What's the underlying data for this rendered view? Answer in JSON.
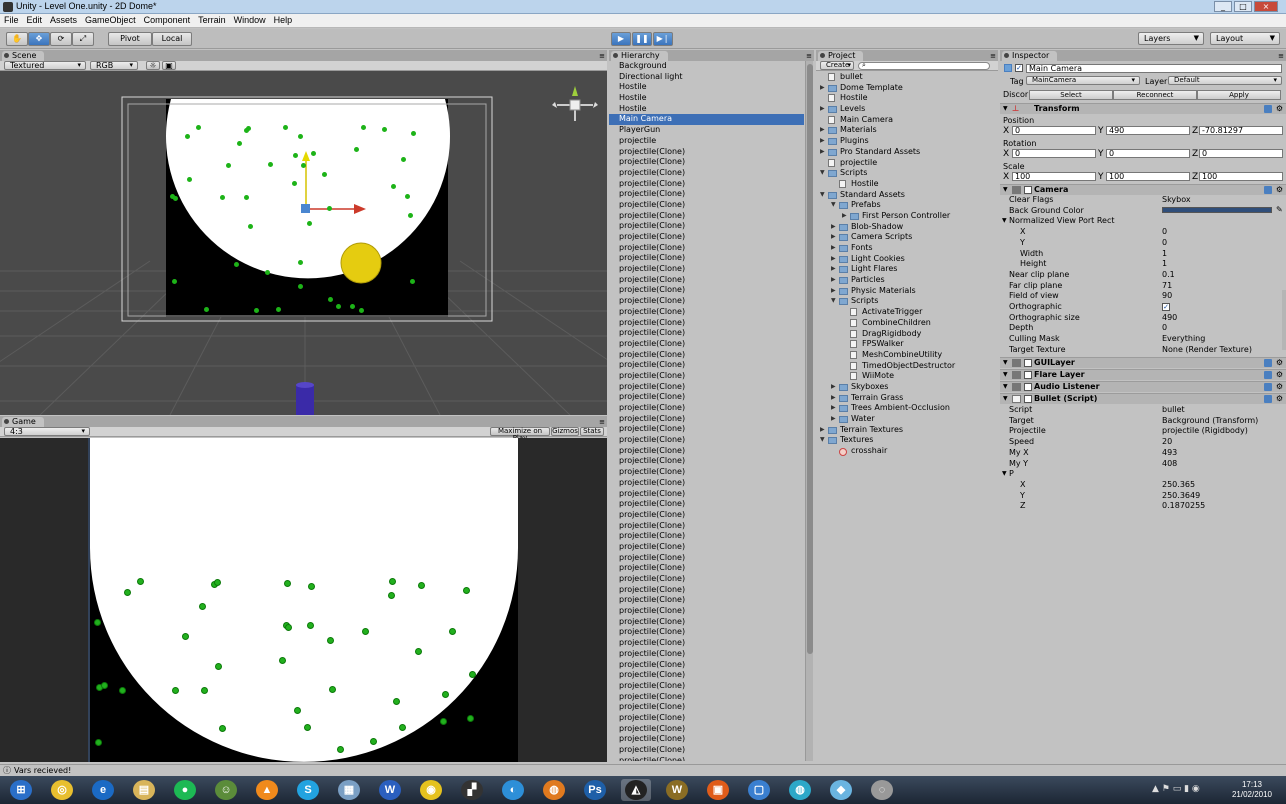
{
  "window": {
    "title": "Unity - Level One.unity - 2D Dome*",
    "controls": [
      "_",
      "□",
      "×"
    ]
  },
  "menu": [
    "File",
    "Edit",
    "Assets",
    "GameObject",
    "Component",
    "Terrain",
    "Window",
    "Help"
  ],
  "toolbar": {
    "pivot_label": "Pivot",
    "local_label": "Local",
    "layers_label": "Layers",
    "layout_label": "Layout"
  },
  "scene": {
    "tab_label": "Scene",
    "render_mode": "Textured",
    "color_mode": "RGB"
  },
  "game": {
    "tab_label": "Game",
    "aspect": "4:3",
    "maximize_label": "Maximize on Play",
    "gizmos_label": "Gizmos",
    "stats_label": "Stats"
  },
  "hierarchy": {
    "tab_label": "Hierarchy",
    "items": [
      "Background",
      "Directional light",
      "Hostile",
      "Hostile",
      "Hostile",
      "Main Camera",
      "PlayerGun",
      "projectile",
      "projectile(Clone)",
      "projectile(Clone)",
      "projectile(Clone)",
      "projectile(Clone)",
      "projectile(Clone)",
      "projectile(Clone)",
      "projectile(Clone)",
      "projectile(Clone)",
      "projectile(Clone)",
      "projectile(Clone)",
      "projectile(Clone)",
      "projectile(Clone)",
      "projectile(Clone)",
      "projectile(Clone)",
      "projectile(Clone)",
      "projectile(Clone)",
      "projectile(Clone)",
      "projectile(Clone)",
      "projectile(Clone)",
      "projectile(Clone)",
      "projectile(Clone)",
      "projectile(Clone)",
      "projectile(Clone)",
      "projectile(Clone)",
      "projectile(Clone)",
      "projectile(Clone)",
      "projectile(Clone)",
      "projectile(Clone)",
      "projectile(Clone)",
      "projectile(Clone)",
      "projectile(Clone)",
      "projectile(Clone)",
      "projectile(Clone)",
      "projectile(Clone)",
      "projectile(Clone)",
      "projectile(Clone)",
      "projectile(Clone)",
      "projectile(Clone)",
      "projectile(Clone)",
      "projectile(Clone)",
      "projectile(Clone)",
      "projectile(Clone)",
      "projectile(Clone)",
      "projectile(Clone)",
      "projectile(Clone)",
      "projectile(Clone)",
      "projectile(Clone)",
      "projectile(Clone)",
      "projectile(Clone)",
      "projectile(Clone)",
      "projectile(Clone)",
      "projectile(Clone)",
      "projectile(Clone)",
      "projectile(Clone)",
      "projectile(Clone)",
      "projectile(Clone)",
      "projectile(Clone)",
      "projectile(Clone)"
    ],
    "selected": "Main Camera"
  },
  "project": {
    "tab_label": "Project",
    "create_label": "Create",
    "items": [
      {
        "label": "bullet",
        "depth": 0,
        "kind": "file",
        "expand": ""
      },
      {
        "label": "Dome Template",
        "depth": 0,
        "kind": "folder",
        "expand": "▶"
      },
      {
        "label": "Hostile",
        "depth": 0,
        "kind": "file",
        "expand": ""
      },
      {
        "label": "Levels",
        "depth": 0,
        "kind": "folder",
        "expand": "▶"
      },
      {
        "label": "Main Camera",
        "depth": 0,
        "kind": "file",
        "expand": ""
      },
      {
        "label": "Materials",
        "depth": 0,
        "kind": "folder",
        "expand": "▶"
      },
      {
        "label": "Plugins",
        "depth": 0,
        "kind": "folder",
        "expand": "▶"
      },
      {
        "label": "Pro Standard Assets",
        "depth": 0,
        "kind": "folder",
        "expand": "▶"
      },
      {
        "label": "projectile",
        "depth": 0,
        "kind": "file",
        "expand": ""
      },
      {
        "label": "Scripts",
        "depth": 0,
        "kind": "folder",
        "expand": "▼"
      },
      {
        "label": "Hostile",
        "depth": 1,
        "kind": "file",
        "expand": ""
      },
      {
        "label": "Standard Assets",
        "depth": 0,
        "kind": "folder",
        "expand": "▼"
      },
      {
        "label": "Prefabs",
        "depth": 1,
        "kind": "folder",
        "expand": "▼"
      },
      {
        "label": "First Person Controller",
        "depth": 2,
        "kind": "folder",
        "expand": "▶"
      },
      {
        "label": "Blob-Shadow",
        "depth": 1,
        "kind": "folder",
        "expand": "▶"
      },
      {
        "label": "Camera Scripts",
        "depth": 1,
        "kind": "folder",
        "expand": "▶"
      },
      {
        "label": "Fonts",
        "depth": 1,
        "kind": "folder",
        "expand": "▶"
      },
      {
        "label": "Light Cookies",
        "depth": 1,
        "kind": "folder",
        "expand": "▶"
      },
      {
        "label": "Light Flares",
        "depth": 1,
        "kind": "folder",
        "expand": "▶"
      },
      {
        "label": "Particles",
        "depth": 1,
        "kind": "folder",
        "expand": "▶"
      },
      {
        "label": "Physic Materials",
        "depth": 1,
        "kind": "folder",
        "expand": "▶"
      },
      {
        "label": "Scripts",
        "depth": 1,
        "kind": "folder",
        "expand": "▼"
      },
      {
        "label": "ActivateTrigger",
        "depth": 2,
        "kind": "file",
        "expand": ""
      },
      {
        "label": "CombineChildren",
        "depth": 2,
        "kind": "file",
        "expand": ""
      },
      {
        "label": "DragRigidbody",
        "depth": 2,
        "kind": "file",
        "expand": ""
      },
      {
        "label": "FPSWalker",
        "depth": 2,
        "kind": "file",
        "expand": ""
      },
      {
        "label": "MeshCombineUtility",
        "depth": 2,
        "kind": "file",
        "expand": ""
      },
      {
        "label": "TimedObjectDestructor",
        "depth": 2,
        "kind": "file",
        "expand": ""
      },
      {
        "label": "WiiMote",
        "depth": 2,
        "kind": "file",
        "expand": ""
      },
      {
        "label": "Skyboxes",
        "depth": 1,
        "kind": "folder",
        "expand": "▶"
      },
      {
        "label": "Terrain Grass",
        "depth": 1,
        "kind": "folder",
        "expand": "▶"
      },
      {
        "label": "Trees Ambient-Occlusion",
        "depth": 1,
        "kind": "folder",
        "expand": "▶"
      },
      {
        "label": "Water",
        "depth": 1,
        "kind": "folder",
        "expand": "▶"
      },
      {
        "label": "Terrain Textures",
        "depth": 0,
        "kind": "folder",
        "expand": "▶"
      },
      {
        "label": "Textures",
        "depth": 0,
        "kind": "folder",
        "expand": "▼"
      },
      {
        "label": "crosshair",
        "depth": 1,
        "kind": "red",
        "expand": ""
      }
    ]
  },
  "inspector": {
    "tab_label": "Inspector",
    "object_name": "Main Camera",
    "tag_label": "Tag",
    "tag_value": "MainCamera",
    "layer_label": "Layer",
    "layer_value": "Default",
    "prefab_label": "Discor",
    "select_label": "Select",
    "reconnect_label": "Reconnect",
    "apply_label": "Apply",
    "transform": {
      "title": "Transform",
      "position_label": "Position",
      "position": {
        "x": "0",
        "y": "490",
        "z": "-70.81297"
      },
      "rotation_label": "Rotation",
      "rotation": {
        "x": "0",
        "y": "0",
        "z": "0"
      },
      "scale_label": "Scale",
      "scale": {
        "x": "100",
        "y": "100",
        "z": "100"
      }
    },
    "camera": {
      "title": "Camera",
      "rows": [
        {
          "label": "Clear Flags",
          "value": "Skybox"
        },
        {
          "label": "Back Ground Color",
          "value": ""
        },
        {
          "label": "Normalized View Port Rect",
          "value": ""
        },
        {
          "label": "X",
          "value": "0"
        },
        {
          "label": "Y",
          "value": "0"
        },
        {
          "label": "Width",
          "value": "1"
        },
        {
          "label": "Height",
          "value": "1"
        },
        {
          "label": "Near clip plane",
          "value": "0.1"
        },
        {
          "label": "Far clip plane",
          "value": "71"
        },
        {
          "label": "Field of view",
          "value": "90"
        },
        {
          "label": "Orthographic",
          "value": "✓"
        },
        {
          "label": "Orthographic size",
          "value": "490"
        },
        {
          "label": "Depth",
          "value": "0"
        },
        {
          "label": "Culling Mask",
          "value": "Everything"
        },
        {
          "label": "Target Texture",
          "value": "None (Render Texture)"
        }
      ],
      "background_color": "#2f4e7a"
    },
    "components": [
      "GUILayer",
      "Flare Layer",
      "Audio Listener"
    ],
    "bullet_script": {
      "title": "Bullet (Script)",
      "rows": [
        {
          "label": "Script",
          "value": "bullet"
        },
        {
          "label": "Target",
          "value": "Background (Transform)"
        },
        {
          "label": "Projectile",
          "value": "projectile (Rigidbody)"
        },
        {
          "label": "Speed",
          "value": "20"
        },
        {
          "label": "My X",
          "value": "493"
        },
        {
          "label": "My Y",
          "value": "408"
        },
        {
          "label": "P",
          "value": ""
        },
        {
          "label": "X",
          "value": "250.365"
        },
        {
          "label": "Y",
          "value": "250.3649"
        },
        {
          "label": "Z",
          "value": "0.1870255"
        }
      ]
    }
  },
  "status": {
    "message": "Vars recieved!"
  },
  "taskbar": {
    "time": "17:13",
    "date": "21/02/2010",
    "apps": [
      "start",
      "chrome",
      "ie",
      "explorer",
      "spotify",
      "network",
      "vlc",
      "skype",
      "notepad",
      "word",
      "dvd",
      "app",
      "browser",
      "blender",
      "photoshop",
      "unity",
      "warcraft",
      "tv",
      "app2",
      "app3",
      "app4",
      "app5"
    ]
  },
  "colors": {
    "selection": "#3d6fb6",
    "sprite_green": "#1db318",
    "sun_yellow": "#e5cc10"
  }
}
